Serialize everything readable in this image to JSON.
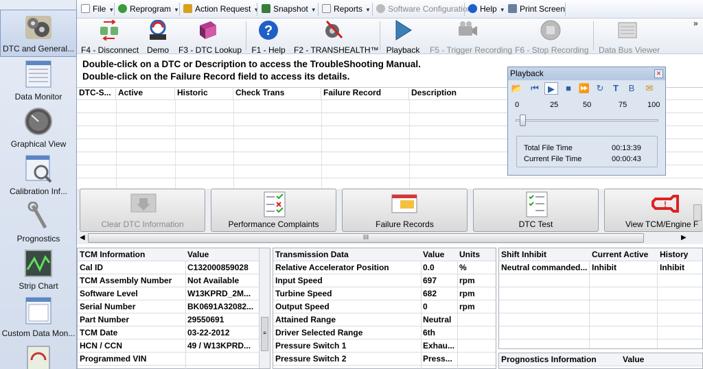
{
  "sidebar": {
    "items": [
      {
        "label": "DTC and General...",
        "icon": "gears-icon",
        "selected": true
      },
      {
        "label": "Data Monitor",
        "icon": "data-monitor-icon"
      },
      {
        "label": "Graphical View",
        "icon": "gauge-icon"
      },
      {
        "label": "Calibration Inf...",
        "icon": "calibration-icon"
      },
      {
        "label": "Prognostics",
        "icon": "wrench-icon"
      },
      {
        "label": "Strip Chart",
        "icon": "strip-chart-icon"
      },
      {
        "label": "Custom Data Mon...",
        "icon": "custom-data-icon"
      }
    ]
  },
  "menu": {
    "file": "File",
    "reprogram": "Reprogram",
    "action_request": "Action Request",
    "snapshot": "Snapshot",
    "reports": "Reports",
    "software_configuration": "Software Configuration",
    "help": "Help",
    "print_screen": "Print Screen"
  },
  "toolbar": {
    "disconnect": "F4 - Disconnect",
    "demo": "Demo",
    "dtc_lookup": "F3 - DTC Lookup",
    "help": "F1 - Help",
    "transhealth": "F2 - TRANSHEALTH™",
    "playback": "Playback",
    "trigger_recording": "F5 - Trigger Recording",
    "stop_recording": "F6 - Stop Recording",
    "data_bus_viewer": "Data Bus Viewer",
    "overflow": "»"
  },
  "instructions": {
    "line1": "Double-click on a DTC or Description to access the TroubleShooting Manual.",
    "line2": "Double-click on the Failure Record field to access its details."
  },
  "dtc_table": {
    "headers": [
      "DTC-S...",
      "Active",
      "Historic",
      "Check Trans",
      "Failure Record",
      "Description"
    ]
  },
  "buttons": {
    "clear_dtc": "Clear DTC Information",
    "performance_complaints": "Performance Complaints",
    "failure_records": "Failure Records",
    "dtc_test": "DTC Test",
    "view_tcm_engine": "View TCM/Engine F",
    "scroll_grip": "III"
  },
  "tcm_info": {
    "headers": [
      "TCM Information",
      "Value"
    ],
    "rows": [
      [
        "Cal ID",
        "C132000859028"
      ],
      [
        "TCM Assembly Number",
        "Not Available"
      ],
      [
        "Software Level",
        "W13KPRD_2M..."
      ],
      [
        "Serial Number",
        "BK0691A32082..."
      ],
      [
        "Part Number",
        "29550691"
      ],
      [
        "TCM Date",
        "03-22-2012"
      ],
      [
        "HCN / CCN",
        "49 / W13KPRD..."
      ],
      [
        "Programmed VIN",
        ""
      ]
    ]
  },
  "transmission_data": {
    "headers": [
      "Transmission Data",
      "Value",
      "Units"
    ],
    "rows": [
      [
        "Relative Accelerator Position",
        "0.0",
        "%"
      ],
      [
        "Input Speed",
        "697",
        "rpm"
      ],
      [
        "Turbine Speed",
        "682",
        "rpm"
      ],
      [
        "Output Speed",
        "0",
        "rpm"
      ],
      [
        "Attained Range",
        "Neutral",
        ""
      ],
      [
        "Driver Selected Range",
        "6th",
        ""
      ],
      [
        "Pressure Switch 1",
        "Exhau...",
        ""
      ],
      [
        "Pressure Switch 2",
        "Press...",
        ""
      ]
    ]
  },
  "shift_inhibit": {
    "headers": [
      "Shift Inhibit",
      "Current Active",
      "History"
    ],
    "rows": [
      [
        "Neutral commanded...",
        "Inhibit",
        "Inhibit"
      ]
    ]
  },
  "prognostics": {
    "headers": [
      "Prognostics Information",
      "Value"
    ]
  },
  "playback": {
    "title": "Playback",
    "close": "✕",
    "controls": {
      "open": "📂",
      "begin": "⏮",
      "play": "▶",
      "stop": "■",
      "fast_forward": "⏩",
      "loop": "↻",
      "text": "T",
      "bold": "B",
      "mail": "✉"
    },
    "scale": [
      "0",
      "25",
      "50",
      "75",
      "100"
    ],
    "slider_value": 5,
    "total_label": "Total File Time",
    "total_value": "00:13:39",
    "current_label": "Current File Time",
    "current_value": "00:00:43"
  },
  "colors": {
    "accent": "#2c5fa8",
    "sidebar": "#d9e2f0"
  }
}
